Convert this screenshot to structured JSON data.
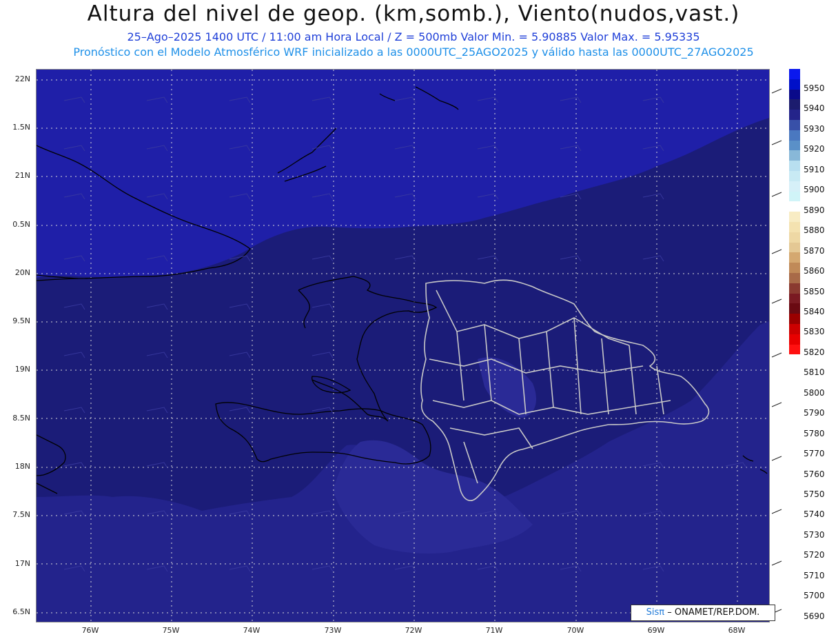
{
  "header": {
    "title": "Altura del nivel de geop. (km,somb.), Viento(nudos,vast.)",
    "subtitle_time": "25–Ago–2025 1400 UTC / 11:00 am Hora Local / Z = 500mb    Valor Min. = 5.90885  Valor Max. = 5.95335",
    "subtitle_model": "Pronóstico con el Modelo Atmosférico WRF inicializado a las 0000UTC_25AGO2025 y válido hasta las  0000UTC_27AGO2025"
  },
  "map": {
    "lat_labels": [
      "22N",
      "1.5N",
      "21N",
      "0.5N",
      "20N",
      "9.5N",
      "19N",
      "8.5N",
      "18N",
      "7.5N",
      "17N",
      "6.5N"
    ],
    "lon_labels": [
      "76W",
      "75W",
      "74W",
      "73W",
      "72W",
      "71W",
      "70W",
      "69W",
      "68W"
    ],
    "colors": {
      "north": "#1f1fa8",
      "middle": "#1b1c78",
      "south": "#23238c",
      "border": "#c8c8c8",
      "coast": "#000000"
    }
  },
  "colorbar": {
    "labels": [
      "5950",
      "5940",
      "5930",
      "5920",
      "5910",
      "5900",
      "5890",
      "5880",
      "5870",
      "5860",
      "5850",
      "5840",
      "5830",
      "5820",
      "5810",
      "5800",
      "5790",
      "5780",
      "5770",
      "5760",
      "5750",
      "5740",
      "5730",
      "5720",
      "5710",
      "5700",
      "5690"
    ],
    "colors": [
      "#0a18ee",
      "#0010c8",
      "#0a0a8a",
      "#1c1c6e",
      "#24248a",
      "#3850a8",
      "#4a78c0",
      "#5a90c8",
      "#88b8d8",
      "#b8dff0",
      "#c8eaf4",
      "#d6f0f8",
      "#d0f4f8",
      "#ffffff",
      "#f8ecc4",
      "#f4e2b0",
      "#eed8a4",
      "#e4c894",
      "#d4a870",
      "#c08a58",
      "#a86a48",
      "#8a3a30",
      "#7a1a22",
      "#6a0a12",
      "#9a0000",
      "#cc0000",
      "#e80000",
      "#ff1010"
    ]
  },
  "credit": {
    "sis": "Sisπ",
    "org": "– ONAMET/REP.DOM."
  }
}
